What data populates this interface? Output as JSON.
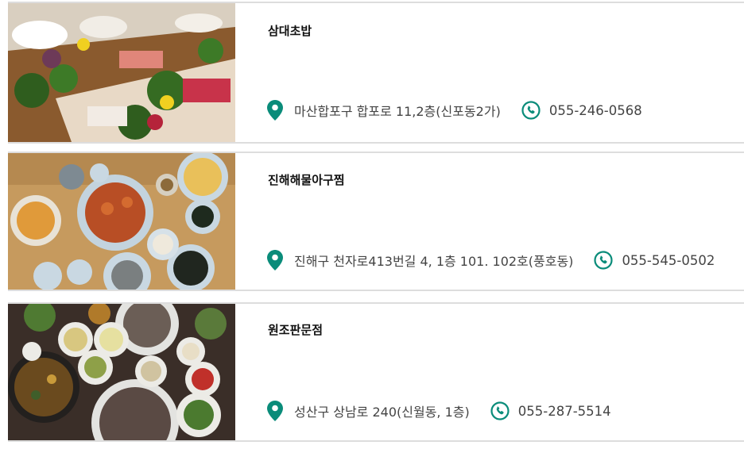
{
  "accent_color": "#0a8c7a",
  "restaurants": [
    {
      "name": "삼대초밥",
      "address": "마산합포구 합포로 11,2층(신포동2가)",
      "phone": "055-246-0568",
      "image_icon": "sashimi-platter-photo"
    },
    {
      "name": "진해해물아구찜",
      "address": "진해구 천자로413번길 4, 1층 101. 102호(풍호동)",
      "phone": "055-545-0502",
      "image_icon": "braised-monkfish-photo"
    },
    {
      "name": "원조판문점",
      "address": "성산구 상남로 240(신월동, 1층)",
      "phone": "055-287-5514",
      "image_icon": "korean-side-dishes-photo"
    }
  ],
  "icons": {
    "location": "map-pin-icon",
    "phone": "phone-circle-icon"
  }
}
